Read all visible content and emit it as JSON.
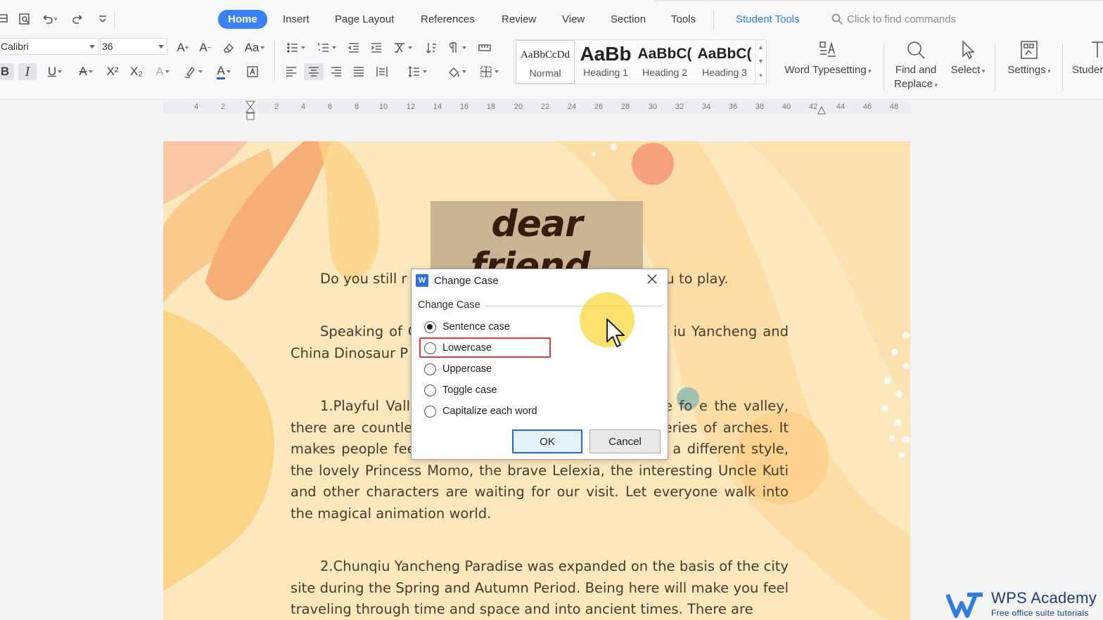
{
  "tabs": {
    "home": "Home",
    "insert": "Insert",
    "page_layout": "Page Layout",
    "references": "References",
    "review": "Review",
    "view": "View",
    "section": "Section",
    "tools": "Tools",
    "student_tools": "Student Tools",
    "search_placeholder": "Click to find commands"
  },
  "ribbon": {
    "font_name": "Calibri",
    "font_size": "36",
    "bold": "B",
    "italic": "I",
    "underline": "U",
    "font_color_letter": "A",
    "case_button": "Aa",
    "superscript": "X²",
    "subscript": "X₂",
    "styles": [
      {
        "preview": "AaBbCcDd",
        "name": "Normal"
      },
      {
        "preview": "AaBb",
        "name": "Heading 1"
      },
      {
        "preview": "AaBbC(",
        "name": "Heading 2"
      },
      {
        "preview": "AaBbC(",
        "name": "Heading 3"
      }
    ],
    "word_typesetting": "Word Typesetting",
    "find_replace_1": "Find and",
    "find_replace_2": "Replace",
    "select": "Select",
    "settings": "Settings",
    "student": "Studer"
  },
  "ruler": [
    "4",
    "2",
    "2",
    "4",
    "6",
    "8",
    "10",
    "12",
    "14",
    "16",
    "18",
    "20",
    "22",
    "24",
    "26",
    "28",
    "30",
    "32",
    "34",
    "36",
    "38",
    "40",
    "42",
    "44",
    "46",
    "48"
  ],
  "document": {
    "title": "dear friend,",
    "p1": "Do you still r                                                          to come. I would like to invite you t                                                      ou to play.",
    "p2": "Speaking of C                                                      ree major theme parks in Changzh                                                  iu Yancheng and China Dinosaur P",
    "p3": "1.Playful Valle                                                      uilt by the lake. It is a good place fo                                                   e the valley, there are countless im                                                      eside the bridge, forming a series of arches. It makes people feel as if they are in Thailand. Yanai is a different style, the lovely Princess Momo, the brave Lelexia, the interesting Uncle Kuti and other characters are waiting for our visit. Let everyone walk into the magical animation world.",
    "p4": "2.Chunqiu Yancheng Paradise was expanded on the basis of the city site during the Spring and Autumn Period. Being here will make you feel traveling through time and space and into ancient times. There are"
  },
  "dialog": {
    "title": "Change Case",
    "group_label": "Change Case",
    "options": [
      "Sentence case",
      "Lowercase",
      "Uppercase",
      "Toggle case",
      "Capitalize each word"
    ],
    "selected": "Sentence case",
    "ok": "OK",
    "cancel": "Cancel"
  },
  "watermark": {
    "brand": "WPS Academy",
    "tagline": "Free office suite tutorials"
  },
  "colors": {
    "accent": "#3b82f6",
    "highlight_box": "#e53935",
    "page_bg": "#fde7bd"
  }
}
